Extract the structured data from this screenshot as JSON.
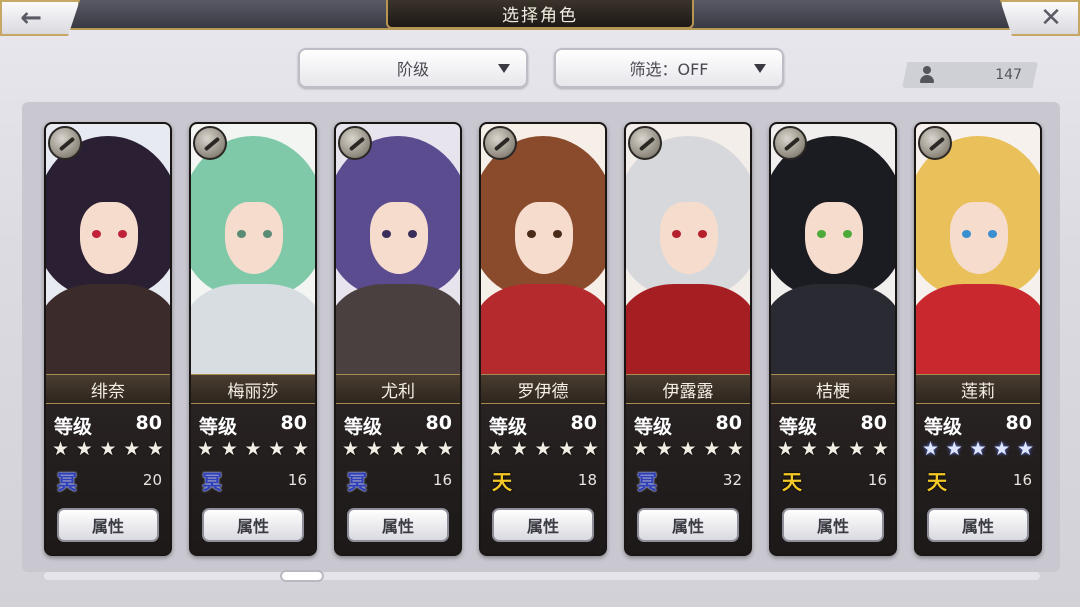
{
  "header": {
    "title": "选择角色",
    "back_icon": "←",
    "close_icon": "✕"
  },
  "filters": {
    "rank_label": "阶级",
    "filter_label": "筛选：OFF"
  },
  "owned_count": "147",
  "card_common": {
    "level_label": "等级",
    "button_label": "属性",
    "star": "★"
  },
  "characters": [
    {
      "name": "绯奈",
      "level": "80",
      "attr": "冥",
      "attr_type": "dark",
      "cost": "20",
      "stars_style": "white",
      "colors": {
        "hair": "#2a1f33",
        "body": "#3b2b2b",
        "eye": "#c0223a",
        "accent": "#e7eaf0"
      }
    },
    {
      "name": "梅丽莎",
      "level": "80",
      "attr": "冥",
      "attr_type": "dark",
      "cost": "16",
      "stars_style": "white",
      "colors": {
        "hair": "#7fc9a9",
        "body": "#d8dde2",
        "eye": "#5a8b74",
        "accent": "#f3f5f2"
      }
    },
    {
      "name": "尤利",
      "level": "80",
      "attr": "冥",
      "attr_type": "dark",
      "cost": "16",
      "stars_style": "white",
      "colors": {
        "hair": "#5b4b8f",
        "body": "#4a4040",
        "eye": "#3a2f5a",
        "accent": "#e8e4ee"
      }
    },
    {
      "name": "罗伊德",
      "level": "80",
      "attr": "天",
      "attr_type": "sky",
      "cost": "18",
      "stars_style": "white",
      "colors": {
        "hair": "#8a4b2c",
        "body": "#b52a2c",
        "eye": "#4a2a18",
        "accent": "#f5efe8"
      }
    },
    {
      "name": "伊露露",
      "level": "80",
      "attr": "冥",
      "attr_type": "dark",
      "cost": "32",
      "stars_style": "white",
      "colors": {
        "hair": "#d6d8dc",
        "body": "#a51e22",
        "eye": "#b5202c",
        "accent": "#f3eeea"
      }
    },
    {
      "name": "桔梗",
      "level": "80",
      "attr": "天",
      "attr_type": "sky",
      "cost": "16",
      "stars_style": "white",
      "colors": {
        "hair": "#1b1b22",
        "body": "#2a2a33",
        "eye": "#4caa3a",
        "accent": "#f1efee"
      }
    },
    {
      "name": "莲莉",
      "level": "80",
      "attr": "天",
      "attr_type": "sky",
      "cost": "16",
      "stars_style": "blue",
      "colors": {
        "hair": "#e9c05a",
        "body": "#c8282e",
        "eye": "#3a8fd0",
        "accent": "#f6f1ec"
      }
    }
  ]
}
